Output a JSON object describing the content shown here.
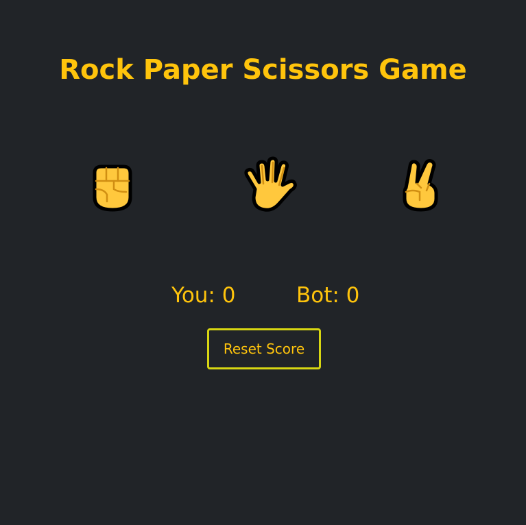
{
  "game": {
    "title": "Rock Paper Scissors Game"
  },
  "choices": [
    {
      "name": "rock",
      "icon": "raised-fist-icon"
    },
    {
      "name": "paper",
      "icon": "raised-hand-icon"
    },
    {
      "name": "scissors",
      "icon": "victory-hand-icon"
    }
  ],
  "score": {
    "you_label": "You: 0",
    "bot_label": "Bot: 0",
    "you": 0,
    "bot": 0
  },
  "reset": {
    "label": "Reset Score"
  },
  "colors": {
    "background": "#212428",
    "accent": "#FFC40C",
    "button_border": "#d8d612"
  }
}
